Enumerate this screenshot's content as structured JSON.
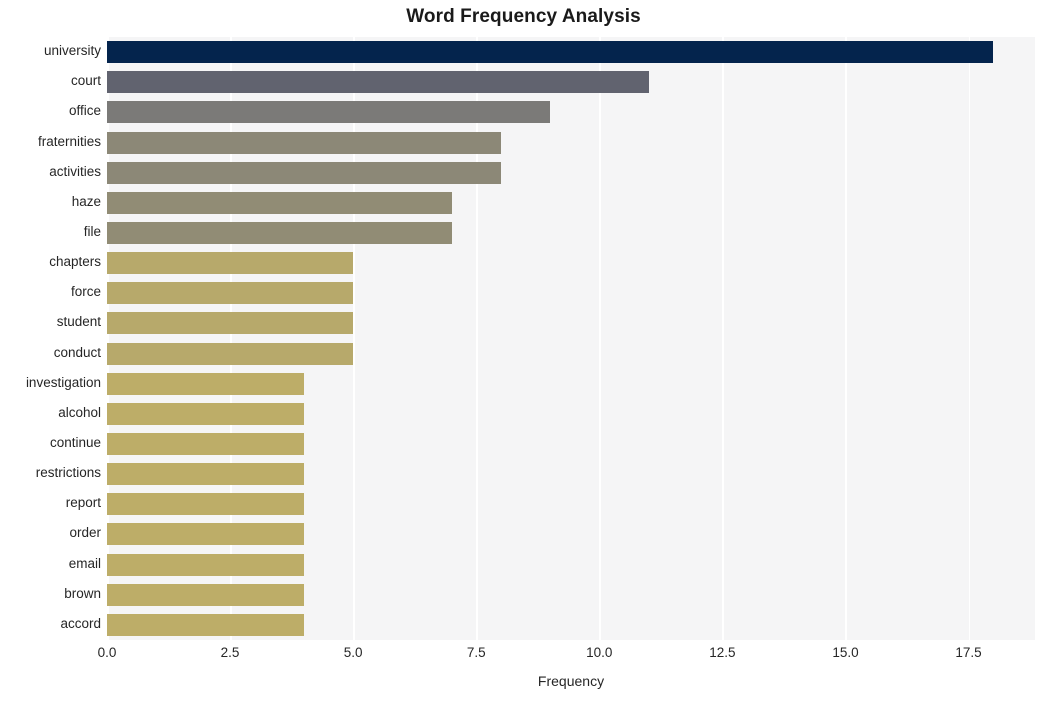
{
  "chart_data": {
    "type": "bar",
    "orientation": "horizontal",
    "title": "Word Frequency Analysis",
    "xlabel": "Frequency",
    "ylabel": "",
    "categories": [
      "university",
      "court",
      "office",
      "fraternities",
      "activities",
      "haze",
      "file",
      "chapters",
      "force",
      "student",
      "conduct",
      "investigation",
      "alcohol",
      "continue",
      "restrictions",
      "report",
      "order",
      "email",
      "brown",
      "accord"
    ],
    "values": [
      18,
      11,
      9,
      8,
      8,
      7,
      7,
      5,
      5,
      5,
      5,
      4,
      4,
      4,
      4,
      4,
      4,
      4,
      4,
      4
    ],
    "bar_colors": [
      "#04244d",
      "#61636f",
      "#7b7a78",
      "#8c8877",
      "#8c8877",
      "#918c75",
      "#918c75",
      "#b7a96b",
      "#b7a96b",
      "#b7a96b",
      "#b7a96b",
      "#bdad68",
      "#bdad68",
      "#bdad68",
      "#bdad68",
      "#bdad68",
      "#bdad68",
      "#bdad68",
      "#bdad68",
      "#bdad68"
    ],
    "xlim": [
      0,
      18.85
    ],
    "xticks": [
      0.0,
      2.5,
      5.0,
      7.5,
      10.0,
      12.5,
      15.0,
      17.5
    ],
    "xticklabels": [
      "0.0",
      "2.5",
      "5.0",
      "7.5",
      "10.0",
      "12.5",
      "15.0",
      "17.5"
    ],
    "grid": "vertical",
    "legend": "none",
    "plot_background": "#f5f5f6",
    "gridline_color": "#ffffff",
    "figure_background": "#ffffff",
    "title_color": "#1a1a1a",
    "tick_color": "#262626"
  }
}
